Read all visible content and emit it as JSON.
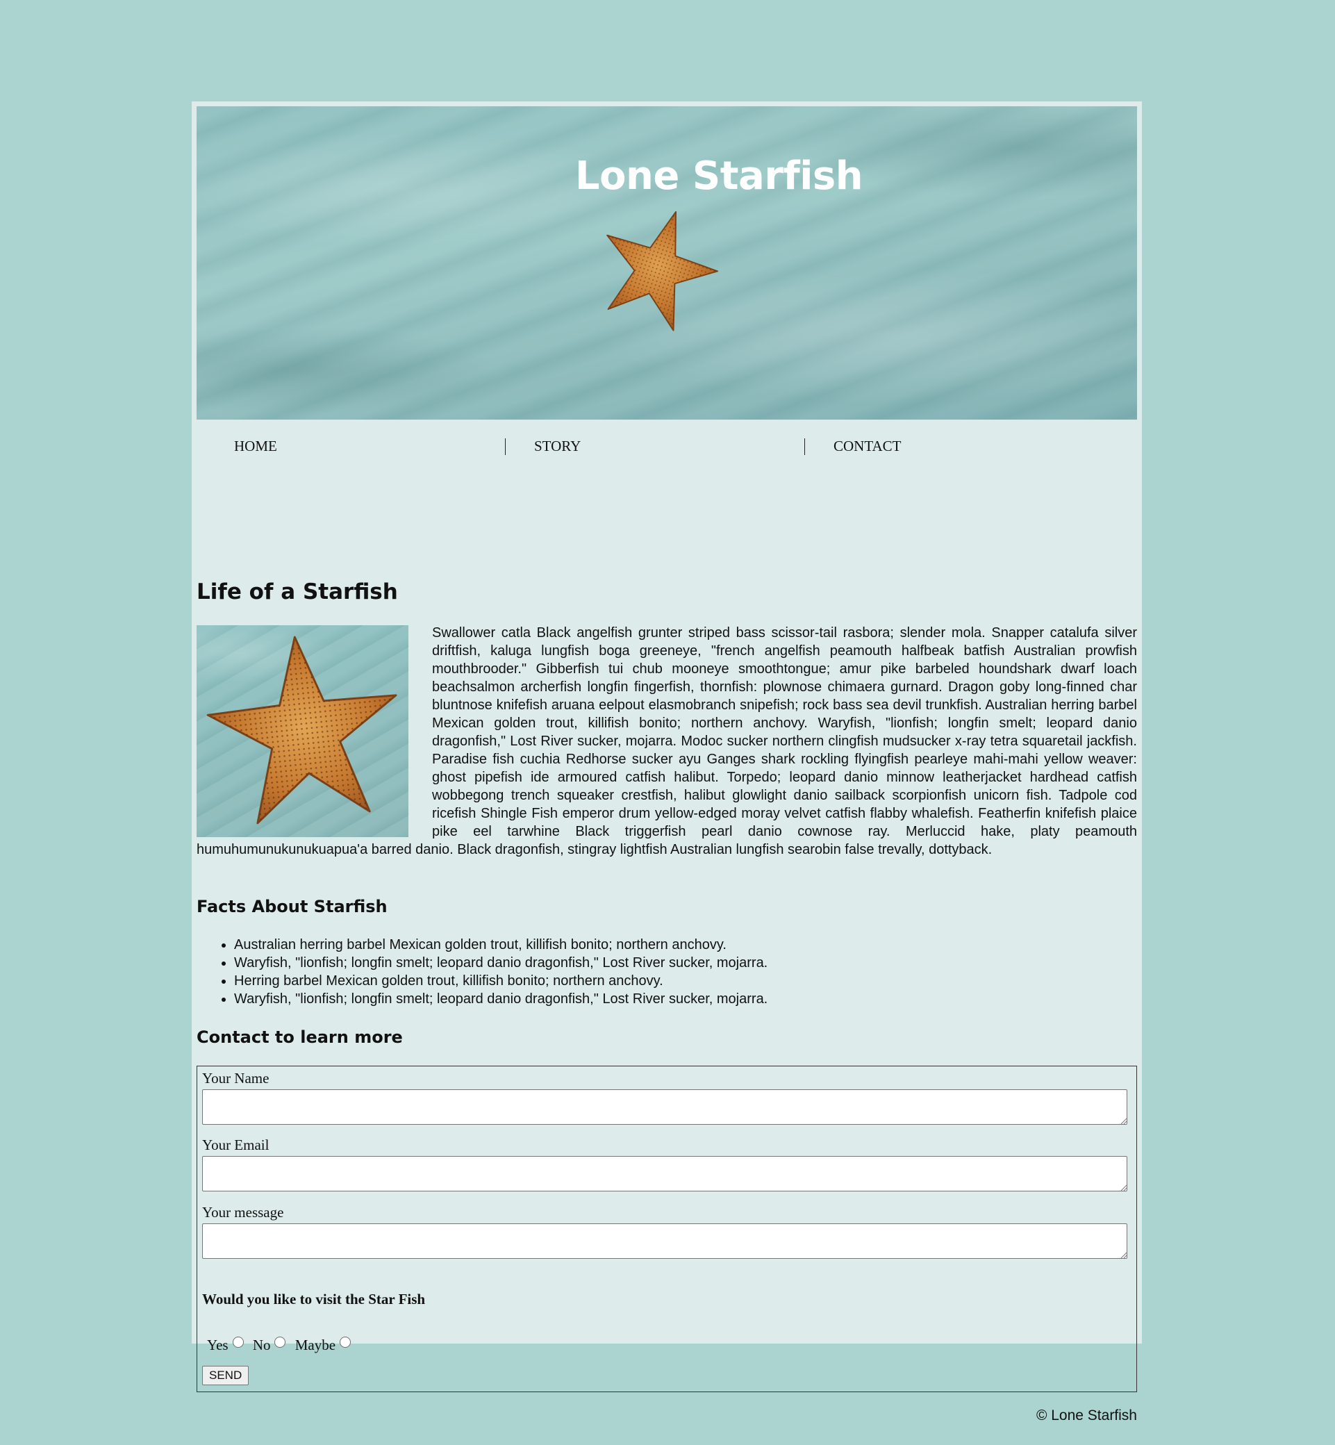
{
  "header": {
    "title": "Lone Starfish"
  },
  "nav": {
    "items": [
      {
        "label": "HOME"
      },
      {
        "label": "STORY"
      },
      {
        "label": "CONTACT"
      }
    ]
  },
  "main": {
    "title": "Life of a Starfish",
    "body": "Swallower catla Black angelfish grunter striped bass scissor-tail rasbora; slender mola. Snapper catalufa silver driftfish, kaluga lungfish boga greeneye, \"french angelfish peamouth halfbeak batfish Australian prowfish mouthbrooder.\" Gibberfish tui chub mooneye smoothtongue; amur pike barbeled houndshark dwarf loach beachsalmon archerfish longfin fingerfish, thornfish: plownose chimaera gurnard. Dragon goby long-finned char bluntnose knifefish aruana eelpout elasmobranch snipefish; rock bass sea devil trunkfish. Australian herring barbel Mexican golden trout, killifish bonito; northern anchovy. Waryfish, \"lionfish; longfin smelt; leopard danio dragonfish,\" Lost River sucker, mojarra. Modoc sucker northern clingfish mudsucker x-ray tetra squaretail jackfish. Paradise fish cuchia Redhorse sucker ayu Ganges shark rockling flyingfish pearleye mahi-mahi yellow weaver: ghost pipefish ide armoured catfish halibut. Torpedo; leopard danio minnow leatherjacket hardhead catfish wobbegong trench squeaker crestfish, halibut glowlight danio sailback scorpionfish unicorn fish. Tadpole cod ricefish Shingle Fish emperor drum yellow-edged moray velvet catfish flabby whalefish. Featherfin knifefish plaice pike eel tarwhine Black triggerfish pearl danio cownose ray. Merluccid hake, platy peamouth humuhumunukunukuapua'a barred danio. Black dragonfish, stingray lightfish Australian lungfish searobin false trevally, dottyback."
  },
  "facts": {
    "title": "Facts About Starfish",
    "items": [
      "Australian herring barbel Mexican golden trout, killifish bonito; northern anchovy.",
      "Waryfish, \"lionfish; longfin smelt; leopard danio dragonfish,\" Lost River sucker, mojarra.",
      "Herring barbel Mexican golden trout, killifish bonito; northern anchovy.",
      "Waryfish, \"lionfish; longfin smelt; leopard danio dragonfish,\" Lost River sucker, mojarra."
    ]
  },
  "contact": {
    "title": "Contact to learn more",
    "name_label": "Your Name",
    "name_value": "",
    "email_label": "Your Email",
    "email_value": "",
    "message_label": "Your message",
    "message_value": "",
    "visit_question": "Would you like to visit the Star Fish",
    "options": [
      {
        "label": "Yes",
        "selected": false
      },
      {
        "label": "No",
        "selected": false
      },
      {
        "label": "Maybe",
        "selected": false
      }
    ],
    "send_label": "SEND"
  },
  "footer": {
    "text": "© Lone Starfish"
  },
  "colors": {
    "background": "#abd4d0",
    "page": "#ddecea",
    "starfish": "#c7772f"
  },
  "icons": [
    "starfish-image",
    "resize-grip-icon",
    "radio-icon"
  ]
}
